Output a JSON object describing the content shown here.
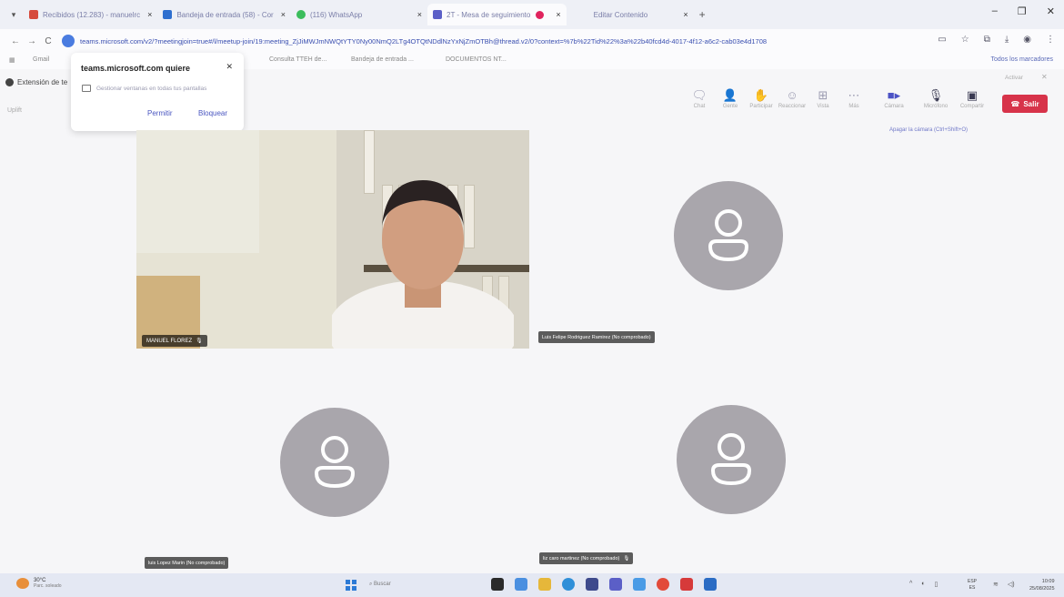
{
  "tabs": [
    {
      "label": "Recibidos (12.283) - manuelrc",
      "icon": "gmail-icon",
      "active": false
    },
    {
      "label": "Bandeja de entrada (58) - Cor",
      "icon": "outlook-icon",
      "active": false
    },
    {
      "label": "(116) WhatsApp",
      "icon": "whatsapp-icon",
      "active": false
    },
    {
      "label": "2T - Mesa de seguimiento",
      "icon": "teams-icon",
      "active": true
    },
    {
      "label": "Editar Contenido",
      "icon": "",
      "active": false
    }
  ],
  "address": {
    "url": "teams.microsoft.com/v2/?meetingjoin=true#/l/meetup-join/19:meeting_ZjJiMWJmNWQtYTY0Ny00NmQ2LTg4OTQtNDdlNzYxNjZmOTBh@thread.v2/0?context=%7b%22Tid%22%3a%22b40fcd4d-4017-4f12-a6c2-cab03e4d1708"
  },
  "bookmarks": {
    "gmail": "Gmail",
    "item2": "Consulta TTEH de...",
    "item3": "Bandeja de entrada ...",
    "item4": "DOCUMENTOS NT...",
    "all": "Todos los marcadores"
  },
  "side": {
    "ext": "Extensión de te",
    "user": "Uplift"
  },
  "popup": {
    "title": "teams.microsoft.com quiere",
    "desc": "Gestionar ventanas en todas tus pantallas",
    "allow": "Permitir",
    "block": "Bloquear"
  },
  "toolbar": {
    "chat": "Chat",
    "people": "Gente",
    "raise": "Participar",
    "react": "Reaccionar",
    "view": "Vista",
    "more": "Más",
    "camera": "Cámara",
    "mic": "Micrófono",
    "share": "Compartir",
    "leave": "Salir",
    "activar": "Activar",
    "cam_tip": "Apagar la cámara (Ctrl+Shift+O)"
  },
  "participants": [
    {
      "name": "MANUEL FLOREZ",
      "muted": true
    },
    {
      "name": "Luis Felipe Rodriguez Ramirez (No comprobado)",
      "muted": false
    },
    {
      "name": "luis Lopez Marin (No comprobado)",
      "muted": false
    },
    {
      "name": "liz caro martinez (No comprobado)",
      "muted": true
    }
  ],
  "taskbar": {
    "weather_temp": "30°C",
    "weather_desc": "Parc. soleado",
    "search": "Buscar",
    "lang1": "ESP",
    "lang2": "ES",
    "time": "10:09",
    "date": "25/08/2025"
  },
  "colors": {
    "leave_button": "#d7334a",
    "accent": "#5b5fc7",
    "avatar_bg": "#a9a6ac"
  }
}
